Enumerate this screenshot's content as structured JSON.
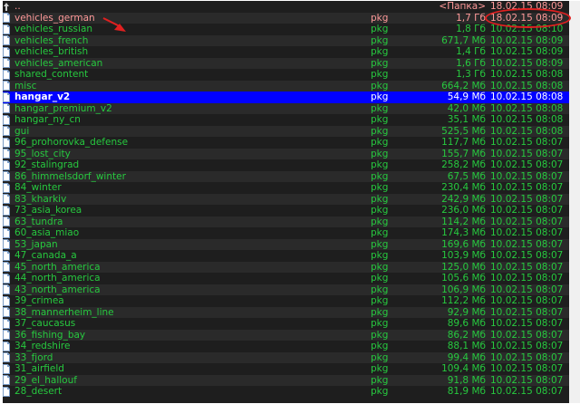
{
  "colors": {
    "background": "#1e1e1e",
    "text_green": "#27c93f",
    "text_tagged": "#ff9a9a",
    "selection": "#0000ff",
    "annotation": "#e02020"
  },
  "icons": {
    "file": "document-icon",
    "up": "up-arrow-icon"
  },
  "up_row": {
    "name": "..",
    "size": "<Папка>",
    "date": "18.02.15 08:09"
  },
  "files": [
    {
      "name": "vehicles_german",
      "ext": "pkg",
      "size": "1,7 Гб",
      "date": "18.02.15 08:09",
      "state": "tagged"
    },
    {
      "name": "vehicles_russian",
      "ext": "pkg",
      "size": "1,8 Гб",
      "date": "10.02.15 08:10"
    },
    {
      "name": "vehicles_french",
      "ext": "pkg",
      "size": "671,7 Мб",
      "date": "10.02.15 08:09"
    },
    {
      "name": "vehicles_british",
      "ext": "pkg",
      "size": "1,4 Гб",
      "date": "10.02.15 08:09"
    },
    {
      "name": "vehicles_american",
      "ext": "pkg",
      "size": "1,6 Гб",
      "date": "10.02.15 08:09"
    },
    {
      "name": "shared_content",
      "ext": "pkg",
      "size": "1,3 Гб",
      "date": "10.02.15 08:08"
    },
    {
      "name": "misc",
      "ext": "pkg",
      "size": "664,2 Мб",
      "date": "10.02.15 08:08"
    },
    {
      "name": "hangar_v2",
      "ext": "pkg",
      "size": "54,9 Мб",
      "date": "10.02.15 08:08",
      "state": "selected"
    },
    {
      "name": "hangar_premium_v2",
      "ext": "pkg",
      "size": "42,0 Мб",
      "date": "10.02.15 08:08"
    },
    {
      "name": "hangar_ny_cn",
      "ext": "pkg",
      "size": "35,1 Мб",
      "date": "10.02.15 08:08"
    },
    {
      "name": "gui",
      "ext": "pkg",
      "size": "525,5 Мб",
      "date": "10.02.15 08:08"
    },
    {
      "name": "96_prohorovka_defense",
      "ext": "pkg",
      "size": "117,7 Мб",
      "date": "10.02.15 08:07"
    },
    {
      "name": "95_lost_city",
      "ext": "pkg",
      "size": "155,7 Мб",
      "date": "10.02.15 08:07"
    },
    {
      "name": "92_stalingrad",
      "ext": "pkg",
      "size": "258,2 Мб",
      "date": "10.02.15 08:07"
    },
    {
      "name": "86_himmelsdorf_winter",
      "ext": "pkg",
      "size": "67,5 Мб",
      "date": "10.02.15 08:07"
    },
    {
      "name": "84_winter",
      "ext": "pkg",
      "size": "230,4 Мб",
      "date": "10.02.15 08:07"
    },
    {
      "name": "83_kharkiv",
      "ext": "pkg",
      "size": "242,9 Мб",
      "date": "10.02.15 08:07"
    },
    {
      "name": "73_asia_korea",
      "ext": "pkg",
      "size": "236,0 Мб",
      "date": "10.02.15 08:07"
    },
    {
      "name": "63_tundra",
      "ext": "pkg",
      "size": "114,2 Мб",
      "date": "10.02.15 08:07"
    },
    {
      "name": "60_asia_miao",
      "ext": "pkg",
      "size": "174,3 Мб",
      "date": "10.02.15 08:07"
    },
    {
      "name": "53_japan",
      "ext": "pkg",
      "size": "169,6 Мб",
      "date": "10.02.15 08:07"
    },
    {
      "name": "47_canada_a",
      "ext": "pkg",
      "size": "103,9 Мб",
      "date": "10.02.15 08:07"
    },
    {
      "name": "45_north_america",
      "ext": "pkg",
      "size": "125,0 Мб",
      "date": "10.02.15 08:07"
    },
    {
      "name": "44_north_america",
      "ext": "pkg",
      "size": "105,6 Мб",
      "date": "10.02.15 08:07"
    },
    {
      "name": "43_north_america",
      "ext": "pkg",
      "size": "106,9 Мб",
      "date": "10.02.15 08:07"
    },
    {
      "name": "39_crimea",
      "ext": "pkg",
      "size": "112,2 Мб",
      "date": "10.02.15 08:07"
    },
    {
      "name": "38_mannerheim_line",
      "ext": "pkg",
      "size": "92,9 Мб",
      "date": "10.02.15 08:07"
    },
    {
      "name": "37_caucasus",
      "ext": "pkg",
      "size": "89,6 Мб",
      "date": "10.02.15 08:07"
    },
    {
      "name": "36_fishing_bay",
      "ext": "pkg",
      "size": "86,2 Мб",
      "date": "10.02.15 08:07"
    },
    {
      "name": "34_redshire",
      "ext": "pkg",
      "size": "88,1 Мб",
      "date": "10.02.15 08:07"
    },
    {
      "name": "33_fjord",
      "ext": "pkg",
      "size": "99,4 Мб",
      "date": "10.02.15 08:07"
    },
    {
      "name": "31_airfield",
      "ext": "pkg",
      "size": "109,4 Мб",
      "date": "10.02.15 08:07"
    },
    {
      "name": "29_el_hallouf",
      "ext": "pkg",
      "size": "91,8 Мб",
      "date": "10.02.15 08:07"
    },
    {
      "name": "28_desert",
      "ext": "pkg",
      "size": "81,9 Мб",
      "date": "10.02.15 08:07"
    }
  ]
}
